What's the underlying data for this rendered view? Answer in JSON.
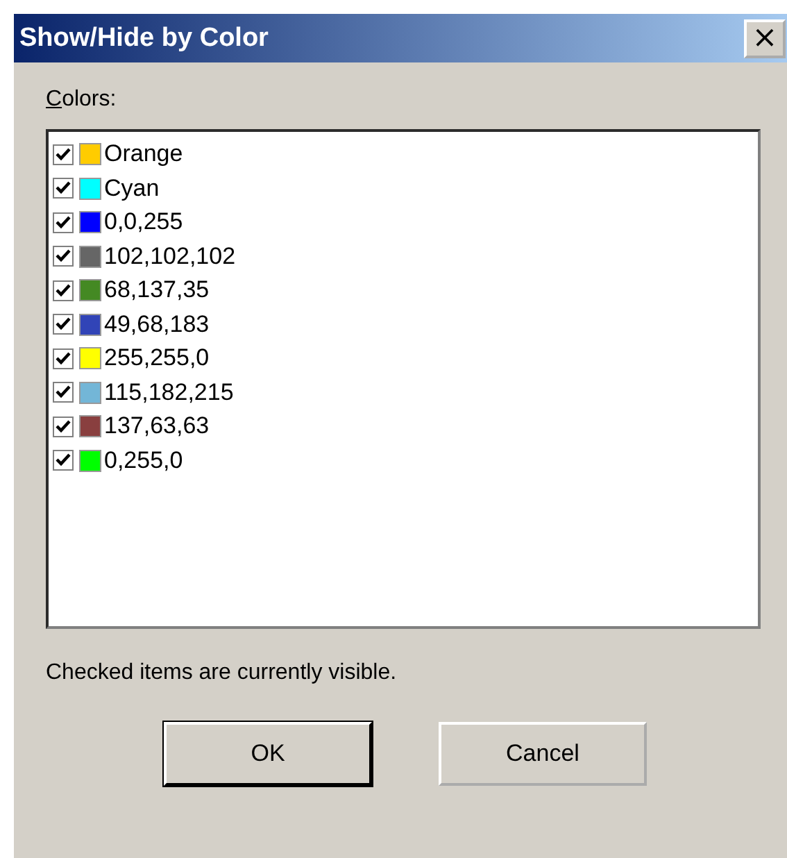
{
  "window": {
    "title": "Show/Hide by Color",
    "close": "×"
  },
  "colors_label": "Colors:",
  "colors": [
    {
      "label": "Orange",
      "checked": true,
      "color": "#ffcc00"
    },
    {
      "label": "Cyan",
      "checked": true,
      "color": "#00ffff"
    },
    {
      "label": "0,0,255",
      "checked": true,
      "color": "#0000ff"
    },
    {
      "label": "102,102,102",
      "checked": true,
      "color": "#666666"
    },
    {
      "label": "68,137,35",
      "checked": true,
      "color": "#448923"
    },
    {
      "label": "49,68,183",
      "checked": true,
      "color": "#3144b7"
    },
    {
      "label": "255,255,0",
      "checked": true,
      "color": "#ffff00"
    },
    {
      "label": "115,182,215",
      "checked": true,
      "color": "#73b6d7"
    },
    {
      "label": "137,63,63",
      "checked": true,
      "color": "#893f3f"
    },
    {
      "label": "0,255,0",
      "checked": true,
      "color": "#00ff00"
    }
  ],
  "hint": "Checked items are currently visible.",
  "buttons": [
    {
      "label": "OK",
      "default": true
    },
    {
      "label": "Cancel",
      "default": false
    }
  ]
}
